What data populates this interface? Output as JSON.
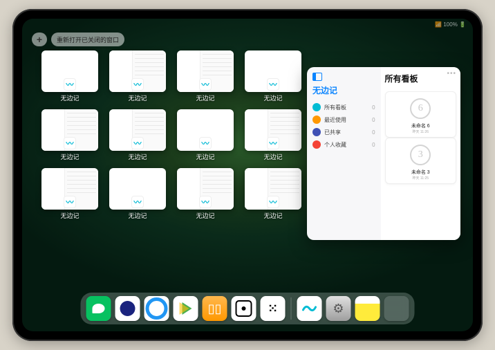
{
  "status": {
    "time_battery": "📶 100% 🔋"
  },
  "top": {
    "add_label": "+",
    "reopen_label": "重新打开已关闭的窗口"
  },
  "app_name": "无边记",
  "windows": [
    {
      "label": "无边记",
      "variant": "blank"
    },
    {
      "label": "无边记",
      "variant": "split"
    },
    {
      "label": "无边记",
      "variant": "split"
    },
    {
      "label": "无边记",
      "variant": "blank"
    },
    {
      "label": "无边记",
      "variant": "split"
    },
    {
      "label": "无边记",
      "variant": "split"
    },
    {
      "label": "无边记",
      "variant": "blank"
    },
    {
      "label": "无边记",
      "variant": "split"
    },
    {
      "label": "无边记",
      "variant": "split"
    },
    {
      "label": "无边记",
      "variant": "blank"
    },
    {
      "label": "无边记",
      "variant": "split"
    },
    {
      "label": "无边记",
      "variant": "split"
    }
  ],
  "panel": {
    "title": "无边记",
    "right_title": "所有看板",
    "sidebar": [
      {
        "label": "所有看板",
        "count": "0",
        "color": "#00bcd4"
      },
      {
        "label": "最近使用",
        "count": "0",
        "color": "#ff9800"
      },
      {
        "label": "已共享",
        "count": "0",
        "color": "#3f51b5"
      },
      {
        "label": "个人收藏",
        "count": "0",
        "color": "#f44336"
      }
    ],
    "boards": [
      {
        "name": "未命名 6",
        "sub": "昨天 11:26",
        "glyph": "6"
      },
      {
        "name": "未命名 3",
        "sub": "昨天 11:25",
        "glyph": "3"
      }
    ]
  },
  "dock": {
    "items": [
      {
        "name": "wechat-icon",
        "cls": "di-wechat"
      },
      {
        "name": "browser1-icon",
        "cls": "di-circle1"
      },
      {
        "name": "browser2-icon",
        "cls": "di-circle2"
      },
      {
        "name": "play-store-icon",
        "cls": "di-play"
      },
      {
        "name": "books-icon",
        "cls": "di-books",
        "glyph": "▯▯"
      },
      {
        "name": "dice-icon",
        "cls": "di-dot"
      },
      {
        "name": "hub-icon",
        "cls": "di-hub",
        "glyph": "⁙"
      },
      {
        "sep": true
      },
      {
        "name": "freeform-icon",
        "cls": "di-freeform",
        "fg": "freeform"
      },
      {
        "name": "settings-icon",
        "cls": "di-gear",
        "glyph": "⚙"
      },
      {
        "name": "notes-icon",
        "cls": "di-notes"
      },
      {
        "name": "app-library-icon",
        "cls": "di-grid4",
        "grid": true
      }
    ]
  }
}
